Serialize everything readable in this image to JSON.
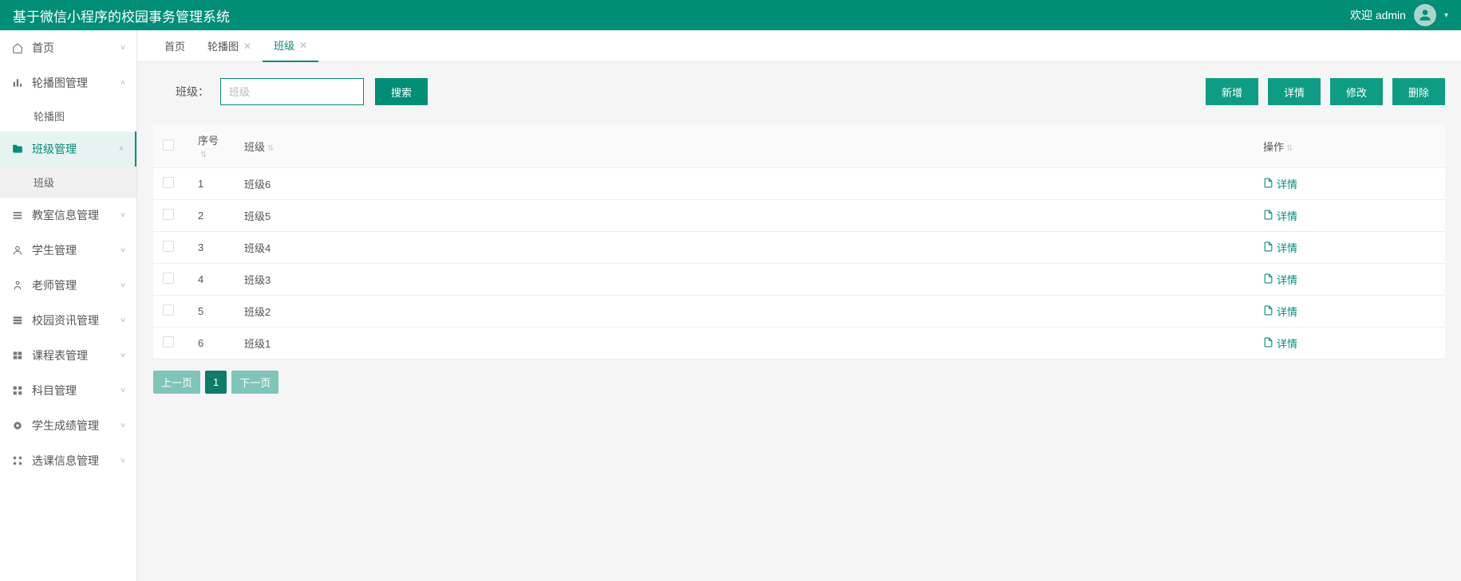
{
  "header": {
    "title": "基于微信小程序的校园事务管理系统",
    "welcome": "欢迎 admin"
  },
  "sidebar": {
    "items": [
      {
        "icon": "home",
        "label": "首页",
        "chev": "down"
      },
      {
        "icon": "chart",
        "label": "轮播图管理",
        "chev": "up",
        "sub": [
          {
            "label": "轮播图"
          }
        ]
      },
      {
        "icon": "folder",
        "label": "班级管理",
        "chev": "up",
        "active": true,
        "sub": [
          {
            "label": "班级",
            "active": true
          }
        ]
      },
      {
        "icon": "list",
        "label": "教室信息管理",
        "chev": "down"
      },
      {
        "icon": "user",
        "label": "学生管理",
        "chev": "down"
      },
      {
        "icon": "person",
        "label": "老师管理",
        "chev": "down"
      },
      {
        "icon": "news",
        "label": "校园资讯管理",
        "chev": "down"
      },
      {
        "icon": "schedule",
        "label": "课程表管理",
        "chev": "down"
      },
      {
        "icon": "grid",
        "label": "科目管理",
        "chev": "down"
      },
      {
        "icon": "disc",
        "label": "学生成绩管理",
        "chev": "down"
      },
      {
        "icon": "apps",
        "label": "选课信息管理",
        "chev": "down"
      }
    ]
  },
  "tabs": [
    {
      "label": "首页",
      "closeable": false
    },
    {
      "label": "轮播图",
      "closeable": true
    },
    {
      "label": "班级",
      "closeable": true,
      "active": true
    }
  ],
  "search": {
    "label": "班级：",
    "placeholder": "班级",
    "button": "搜索"
  },
  "actions": {
    "add": "新增",
    "detail": "详情",
    "edit": "修改",
    "delete": "删除"
  },
  "table": {
    "headers": {
      "index": "序号",
      "name": "班级",
      "action": "操作"
    },
    "rows": [
      {
        "index": "1",
        "name": "班级6"
      },
      {
        "index": "2",
        "name": "班级5"
      },
      {
        "index": "3",
        "name": "班级4"
      },
      {
        "index": "4",
        "name": "班级3"
      },
      {
        "index": "5",
        "name": "班级2"
      },
      {
        "index": "6",
        "name": "班级1"
      }
    ],
    "row_action": "详情"
  },
  "pagination": {
    "prev": "上一页",
    "current": "1",
    "next": "下一页"
  }
}
